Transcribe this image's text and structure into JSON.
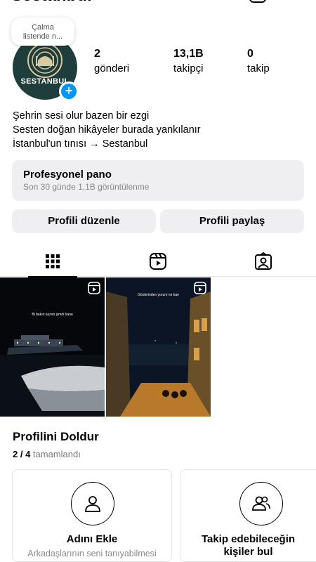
{
  "header": {
    "username": "Sestanbul"
  },
  "note": {
    "line1": "Çalma",
    "line2": "listende n..."
  },
  "avatar": {
    "label": "SESTANBUL"
  },
  "stats": [
    {
      "value": "2",
      "label": "gönderi"
    },
    {
      "value": "13,1B",
      "label": "takipçi"
    },
    {
      "value": "0",
      "label": "takip"
    }
  ],
  "bio": [
    "Şehrin sesi olur bazen bir ezgi",
    "Sesten doğan hikâyeler burada yankılanır",
    "İstanbul'un tınısı → Sestanbul"
  ],
  "dashboard": {
    "title": "Profesyonel pano",
    "subtitle": "Son 30 günde 1,1B görüntülenme"
  },
  "actions": {
    "edit": "Profili düzenle",
    "share": "Profili paylaş"
  },
  "posts": [
    {
      "caption": "Bi bakın kazım şimdi bana"
    },
    {
      "caption": "Gözlerinden yorum ne kan"
    }
  ],
  "complete_profile": {
    "title": "Profilini Doldur",
    "progress": "2 / 4",
    "progress_suffix": "tamamlandı",
    "cards": [
      {
        "title": "Adını Ekle",
        "subtitle": "Arkadaşlarının seni tanıyabilmesi"
      },
      {
        "title_line1": "Takip edebileceğin",
        "title_line2": "kişiler bul"
      }
    ]
  },
  "colors": {
    "accent": "#0095f6",
    "panel": "#efeff1",
    "avatar_bg": "#1f3d3a"
  },
  "icons": [
    "grid-icon",
    "reels-icon",
    "tagged-icon",
    "person-icon",
    "people-icon",
    "plus-icon"
  ]
}
